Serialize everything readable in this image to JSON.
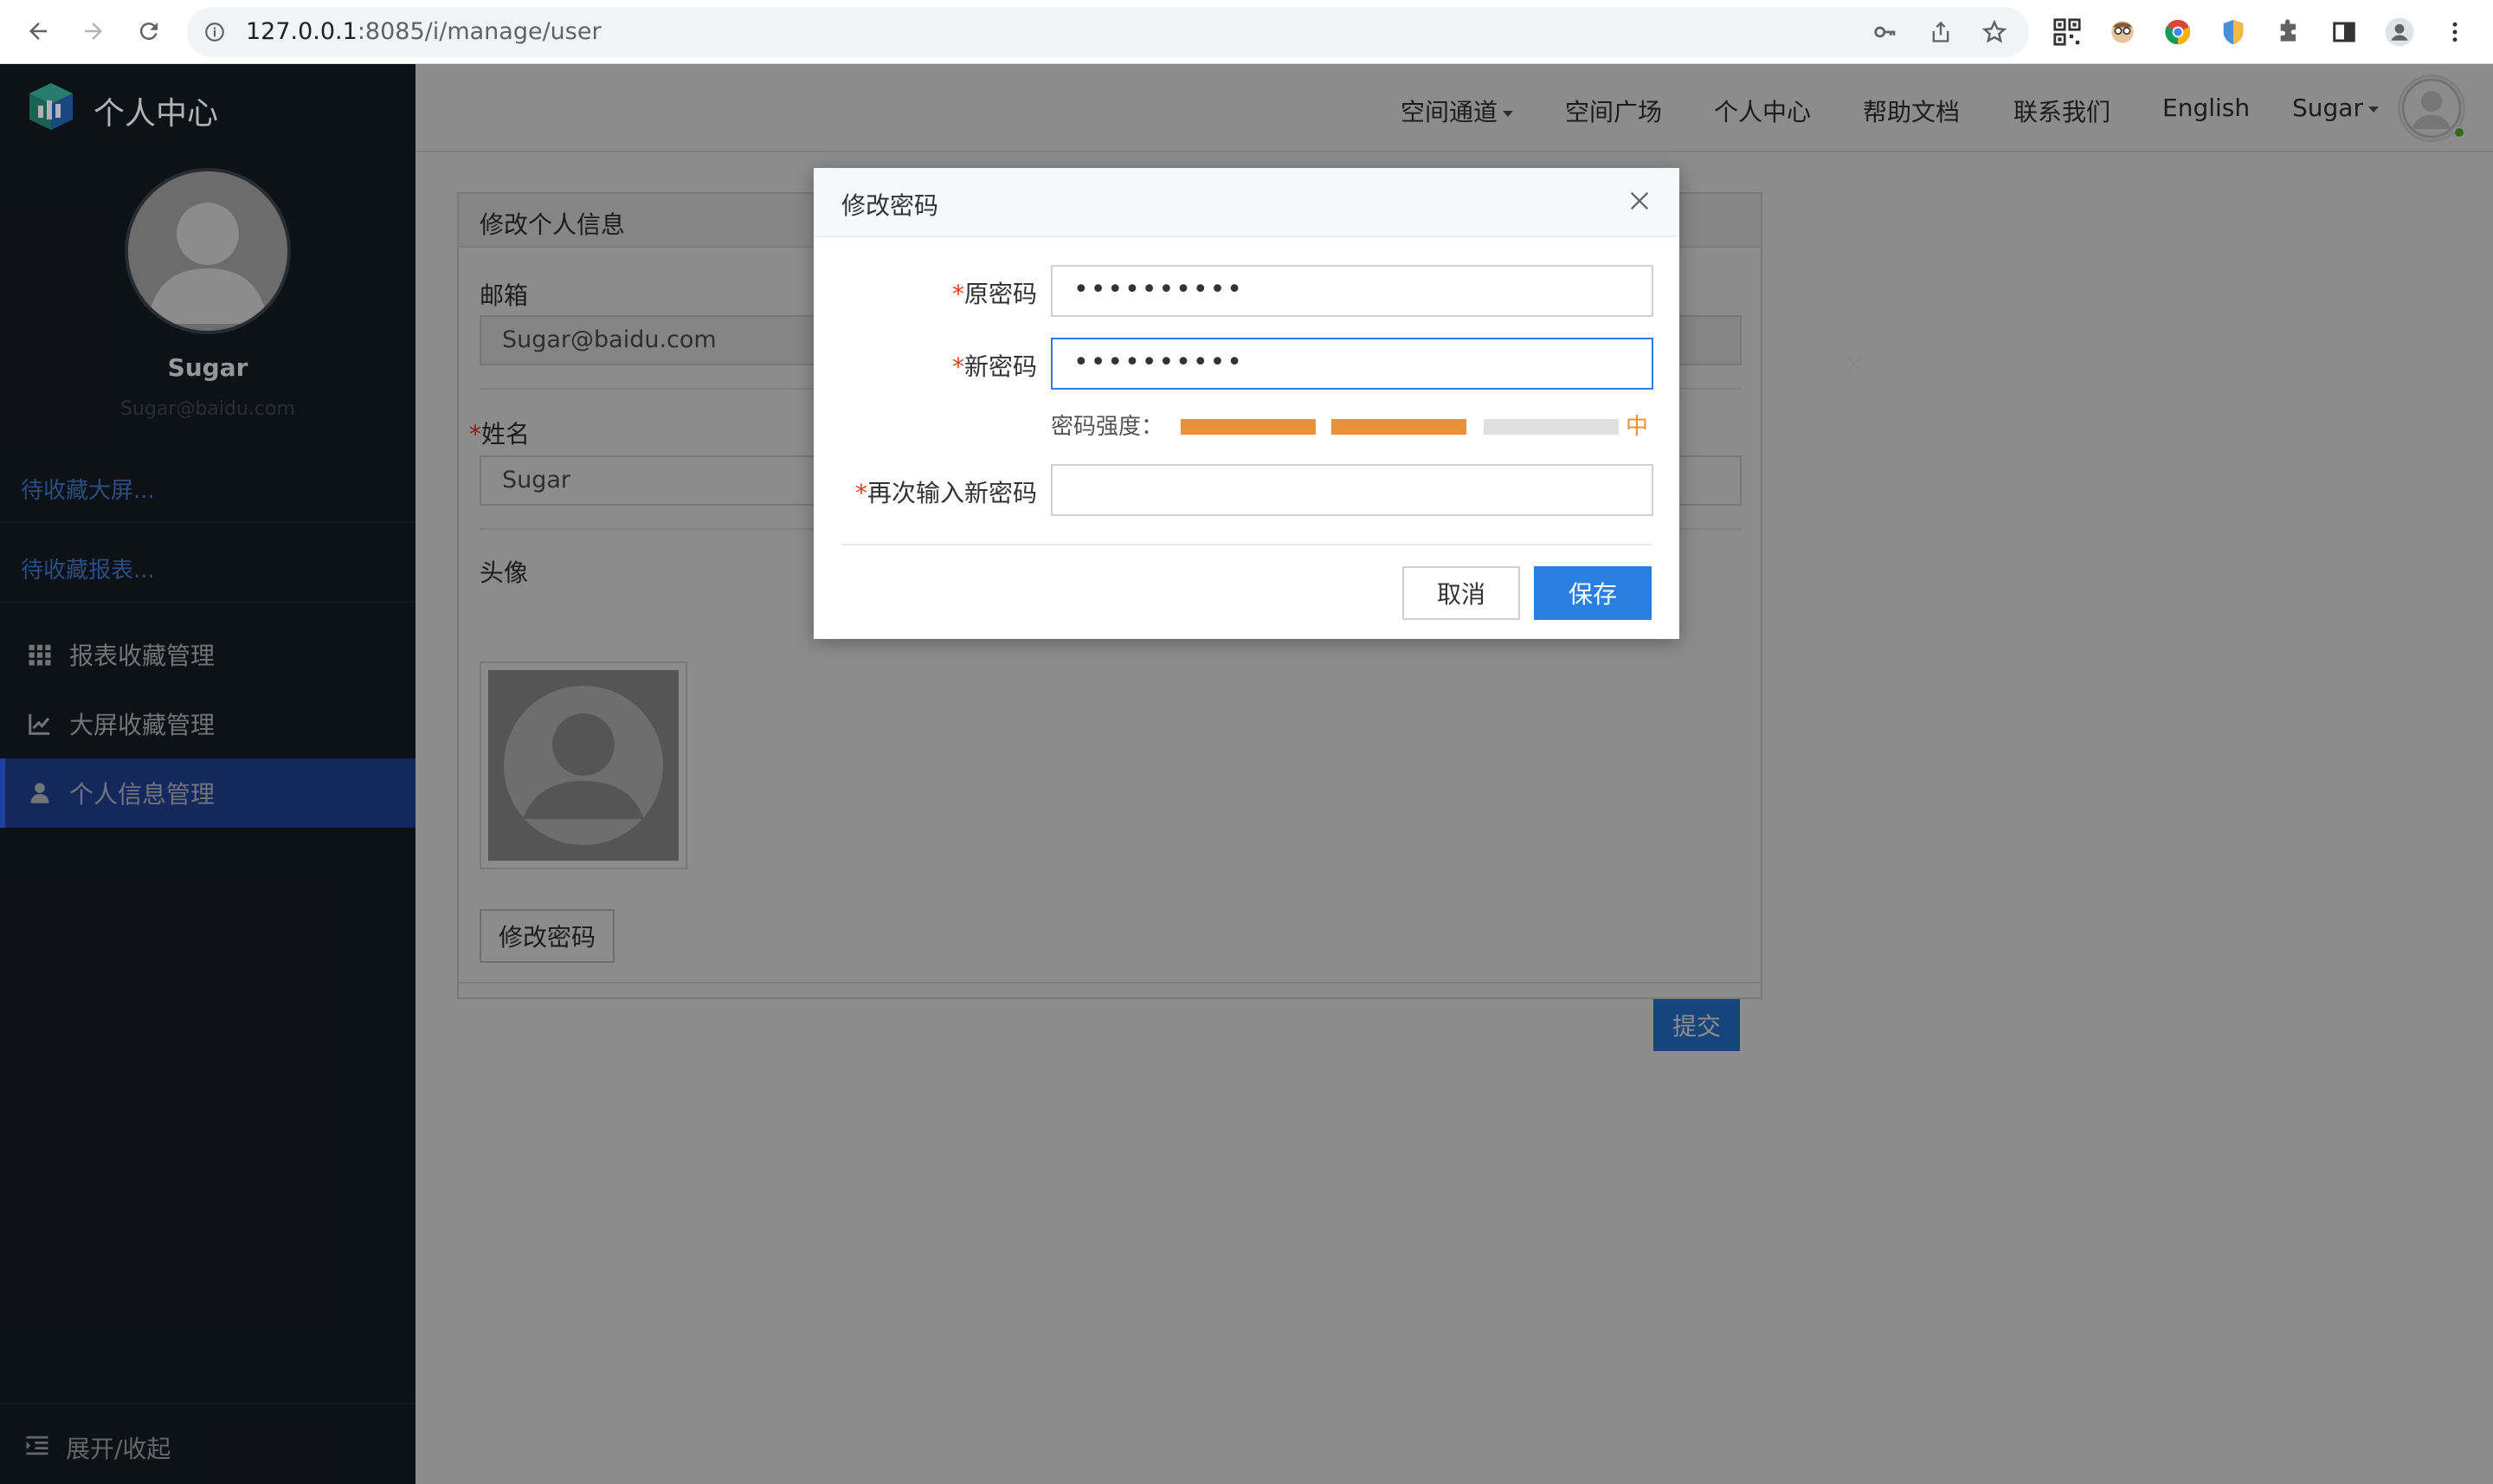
{
  "browser": {
    "url_host": "127.0.0.1",
    "url_rest": ":8085/i/manage/user"
  },
  "sidebar": {
    "app_title": "个人中心",
    "user_name": "Sugar",
    "user_email": "Sugar@baidu.com",
    "links": [
      "待收藏大屏...",
      "待收藏报表..."
    ],
    "menu": [
      {
        "label": "报表收藏管理",
        "icon": "grid-icon"
      },
      {
        "label": "大屏收藏管理",
        "icon": "chart-icon"
      },
      {
        "label": "个人信息管理",
        "icon": "user-icon",
        "active": true
      }
    ],
    "collapse_label": "展开/收起"
  },
  "topnav": {
    "items": [
      "空间通道",
      "空间广场",
      "个人中心",
      "帮助文档",
      "联系我们",
      "English"
    ],
    "user": "Sugar"
  },
  "panel": {
    "title": "修改个人信息",
    "email_label": "邮箱",
    "email_value": "Sugar@baidu.com",
    "name_label": "姓名",
    "name_value": "Sugar",
    "avatar_label": "头像",
    "change_password_button": "修改密码",
    "submit_button": "提交"
  },
  "modal": {
    "title": "修改密码",
    "old_password_label": "原密码",
    "old_password_value": "••••••••••",
    "new_password_label": "新密码",
    "new_password_value": "••••••••••",
    "strength_label": "密码强度：",
    "strength_value": "中",
    "strength_level": 2,
    "strength_max": 3,
    "confirm_label": "再次输入新密码",
    "confirm_value": "",
    "cancel_button": "取消",
    "save_button": "保存",
    "required_mark": "*"
  },
  "colors": {
    "primary": "#2b7fe0",
    "strength_on": "#e8913a",
    "strength_off": "#e0e0e0",
    "sidebar_bg": "#141923",
    "sidebar_active": "#1f3a86"
  }
}
